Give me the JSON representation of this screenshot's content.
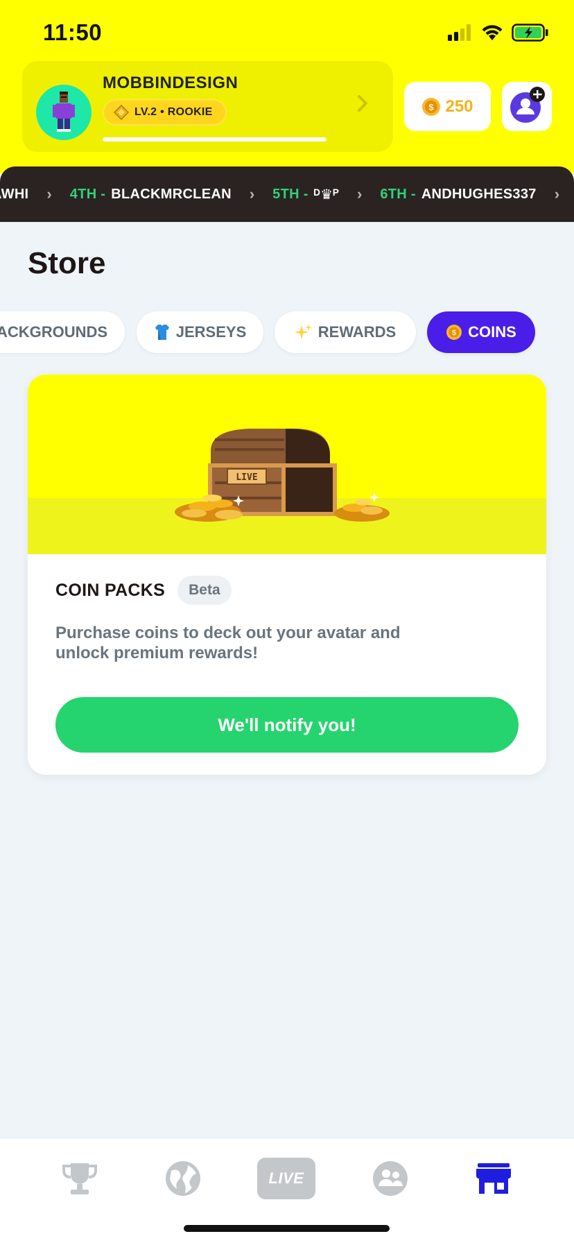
{
  "status_bar": {
    "time": "11:50"
  },
  "profile": {
    "username": "MOBBINDESIGN",
    "level_label": "LV.2 • ROOKIE",
    "level_progress": 1.0
  },
  "coins": {
    "value": "250"
  },
  "ticker": {
    "items": [
      {
        "rank": "",
        "name": "AWHI"
      },
      {
        "rank": "4TH -",
        "name": "BLACKMRCLEAN"
      },
      {
        "rank": "5TH -",
        "name": "ᴰ♛ᴾ"
      },
      {
        "rank": "6TH -",
        "name": "ANDHUGHES337"
      }
    ]
  },
  "store": {
    "title": "Store",
    "tabs": [
      {
        "label": "ACKGROUNDS",
        "icon": ""
      },
      {
        "label": "JERSEYS",
        "icon": "jersey-icon"
      },
      {
        "label": "REWARDS",
        "icon": "sparkles-icon"
      },
      {
        "label": "COINS",
        "icon": "coin-icon",
        "active": true
      }
    ],
    "card": {
      "title": "COIN PACKS",
      "badge": "Beta",
      "description": "Purchase coins to deck out your avatar and unlock premium rewards!",
      "button": "We'll notify you!",
      "chest_label": "LIVE"
    }
  },
  "nav": {
    "items": [
      {
        "name": "trophy-icon",
        "active": false
      },
      {
        "name": "globe-icon",
        "active": false
      },
      {
        "name": "live-icon",
        "label": "LIVE",
        "active": false
      },
      {
        "name": "friends-icon",
        "active": false
      },
      {
        "name": "store-icon",
        "active": true
      }
    ]
  },
  "colors": {
    "header_yellow": "#ffff00",
    "accent_purple": "#4a1ee8",
    "button_green": "#25d46e",
    "rank_green": "#2fd37a",
    "coin_orange": "#f6b21d",
    "nav_active_blue": "#1f1de0",
    "nav_inactive_gray": "#c4c7c9"
  }
}
